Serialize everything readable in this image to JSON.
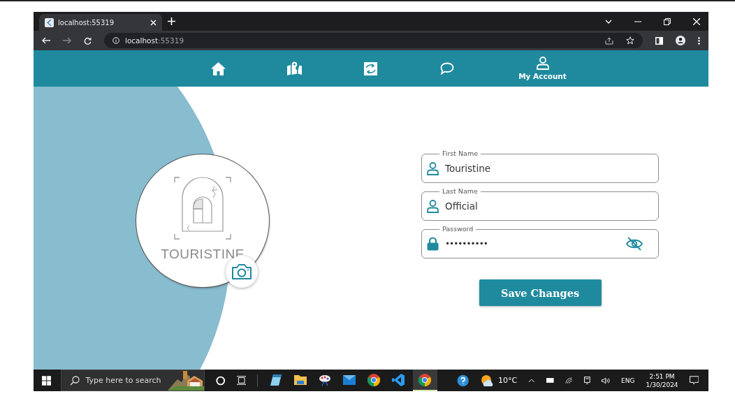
{
  "browser": {
    "tab_title": "localhost:55319",
    "address_host": "localhost",
    "address_port": ":55319"
  },
  "nav": [
    {
      "kind": "home"
    },
    {
      "kind": "map"
    },
    {
      "kind": "swap"
    },
    {
      "kind": "chat"
    },
    {
      "kind": "account",
      "label": "My Account"
    }
  ],
  "profile": {
    "logo_text": "TOURISTINE"
  },
  "form": {
    "fields": [
      {
        "kind": "text",
        "label": "First Name",
        "value": "Touristine"
      },
      {
        "kind": "text",
        "label": "Last Name",
        "value": "Official"
      },
      {
        "kind": "password",
        "label": "Password",
        "value": "••••••••••",
        "revealed": false
      }
    ],
    "submit": "Save Changes"
  },
  "taskbar": {
    "search_placeholder": "Type here to search",
    "apps": [
      {
        "kind": "notes",
        "active": false
      },
      {
        "kind": "folder",
        "active": false
      },
      {
        "kind": "paint",
        "active": false
      },
      {
        "kind": "mail",
        "active": false
      },
      {
        "kind": "chrome",
        "active": false
      },
      {
        "kind": "code",
        "active": false
      },
      {
        "kind": "chrome",
        "active": true
      }
    ],
    "temperature": "10°C",
    "language": "ENG",
    "time": "2:51 PM",
    "date": "1/30/2024"
  }
}
